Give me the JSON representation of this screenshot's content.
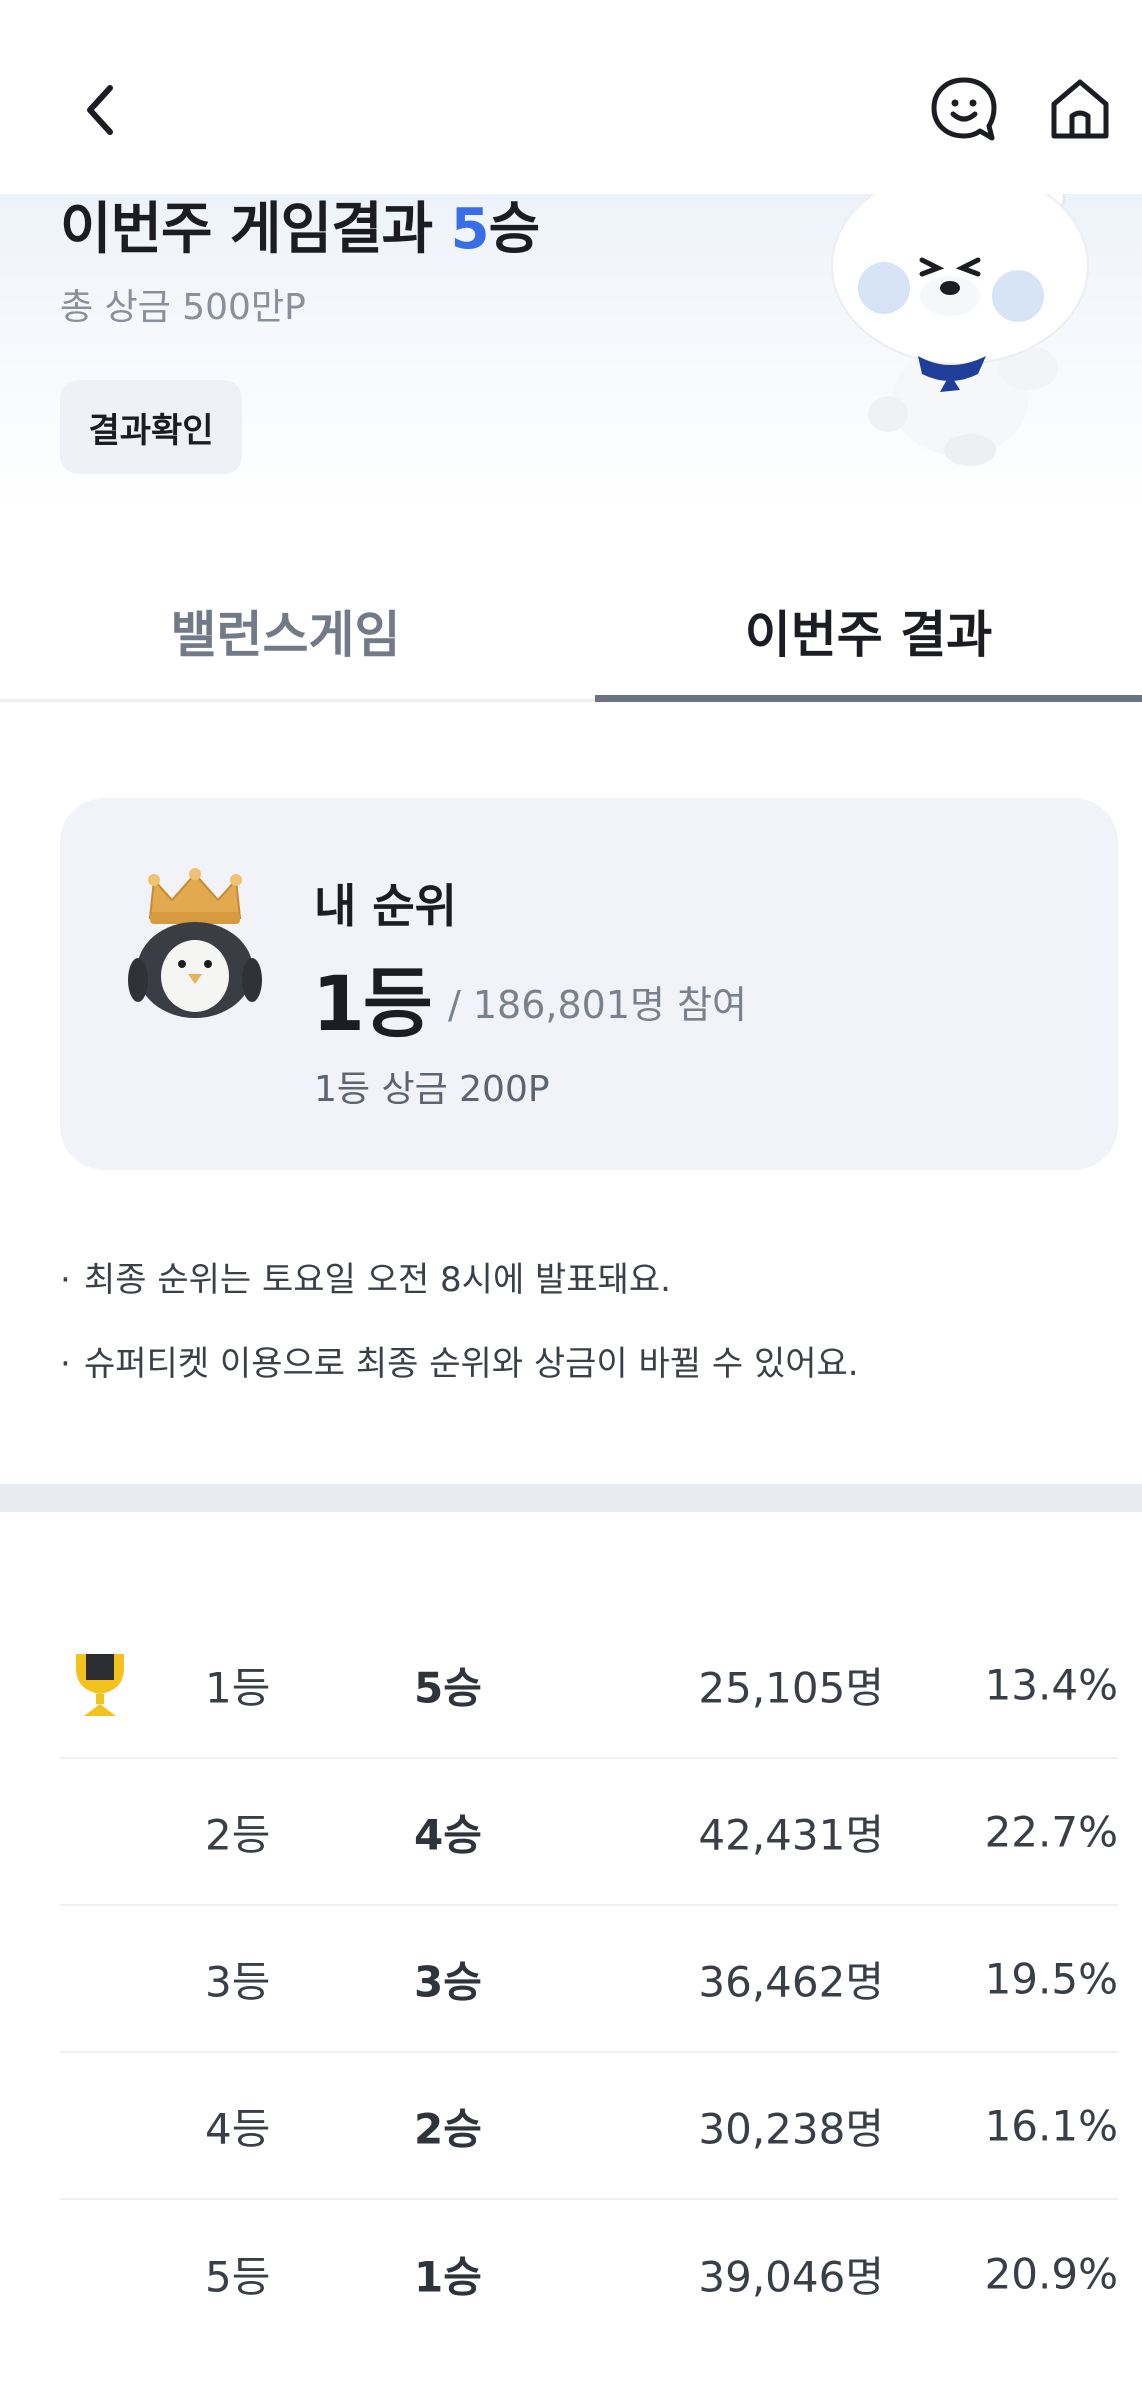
{
  "header": {
    "back_icon": "chevron-left-icon",
    "chat_icon": "smile-chat-icon",
    "home_icon": "home-icon"
  },
  "hero": {
    "title_prefix": "이번주 게임결과 ",
    "title_wins": "5",
    "title_suffix": "승",
    "total_prize": "총 상금 500만P",
    "result_button": "결과확인",
    "accent_color": "#3a6ee8"
  },
  "tabs": [
    {
      "label": "밸런스게임",
      "active": false
    },
    {
      "label": "이번주 결과",
      "active": true
    }
  ],
  "my_rank": {
    "label": "내 순위",
    "rank": "1등",
    "participants": "/ 186,801명 참여",
    "prize": "1등 상금 200P"
  },
  "notices": [
    "최종 순위는 토요일 오전 8시에 발표돼요.",
    "슈퍼티켓 이용으로 최종 순위와 상금이 바뀔 수 있어요."
  ],
  "rank_table": [
    {
      "rank": "1등",
      "wins": "5승",
      "count": "25,105명",
      "percent": "13.4%",
      "trophy": true
    },
    {
      "rank": "2등",
      "wins": "4승",
      "count": "42,431명",
      "percent": "22.7%",
      "trophy": false
    },
    {
      "rank": "3등",
      "wins": "3승",
      "count": "36,462명",
      "percent": "19.5%",
      "trophy": false
    },
    {
      "rank": "4등",
      "wins": "2승",
      "count": "30,238명",
      "percent": "16.1%",
      "trophy": false
    },
    {
      "rank": "5등",
      "wins": "1승",
      "count": "39,046명",
      "percent": "20.9%",
      "trophy": false
    }
  ]
}
